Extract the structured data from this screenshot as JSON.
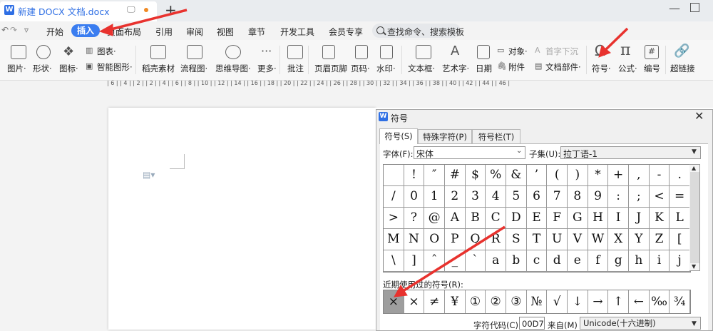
{
  "tab": {
    "app_icon": "W",
    "title": "新建 DOCX 文档.docx",
    "new_tab": "+",
    "minimize": "—"
  },
  "menu": {
    "quick_undo": "↶",
    "quick_redo": "↷",
    "quick_dropdown": "▿",
    "items": [
      "开始",
      "插入",
      "页面布局",
      "引用",
      "审阅",
      "视图",
      "章节",
      "开发工具",
      "会员专享"
    ],
    "search_placeholder": "查找命令、搜索模板"
  },
  "ribbon": {
    "picture": "图片·",
    "shape": "形状·",
    "icon": "图标·",
    "chart": "图表·",
    "smart_graphic": "智能图形·",
    "straw_material": "稻壳素材",
    "flowchart": "流程图·",
    "mindmap": "思维导图·",
    "more": "更多·",
    "comment": "批注",
    "header_footer": "页眉页脚",
    "page_number": "页码·",
    "watermark": "水印·",
    "textbox": "文本框·",
    "wordart": "艺术字·",
    "date": "日期",
    "object": "对象·",
    "attachment": "附件",
    "dropcap": "首字下沉",
    "doc_parts": "文档部件·",
    "symbol": "符号·",
    "formula": "公式·",
    "numbering": "编号",
    "hyperlink": "超链接",
    "formula_glyph": "π",
    "numbering_glyph": "#",
    "symbol_glyph": "Ω"
  },
  "ruler": {
    "text": "| 6 |  | 4 |  | 2 |          | 2 |  | 4 |  | 6 |  | 8 |  | 10 |  | 12 |  | 14 |  | 16 |  | 18 |  | 20 |  | 22 |  | 24 |  | 26 |  | 28 |  | 30 |  | 32 |  | 34 |  | 36 |  | 38 |  | 40 |  | 42 |  | 44 |  | 46 |"
  },
  "dialog": {
    "icon": "W",
    "title": "符号",
    "close": "✕",
    "tabs": [
      "符号(S)",
      "特殊字符(P)",
      "符号栏(T)"
    ],
    "font_label": "字体(F):",
    "font_value": "宋体",
    "subset_label": "子集(U):",
    "subset_value": "拉丁语-1",
    "symbols": [
      [
        "",
        "!",
        "″",
        "#",
        "$",
        "%",
        "&",
        "’",
        "(",
        ")",
        "*",
        "+",
        ",",
        "-",
        "."
      ],
      [
        "/",
        "0",
        "1",
        "2",
        "3",
        "4",
        "5",
        "6",
        "7",
        "8",
        "9",
        ":",
        ";",
        "<",
        "="
      ],
      [
        ">",
        "?",
        "@",
        "A",
        "B",
        "C",
        "D",
        "E",
        "F",
        "G",
        "H",
        "I",
        "J",
        "K",
        "L"
      ],
      [
        "M",
        "N",
        "O",
        "P",
        "Q",
        "R",
        "S",
        "T",
        "U",
        "V",
        "W",
        "X",
        "Y",
        "Z",
        "["
      ],
      [
        "\\",
        "]",
        "ˆ",
        "_",
        "`",
        "a",
        "b",
        "c",
        "d",
        "e",
        "f",
        "g",
        "h",
        "i",
        "j"
      ]
    ],
    "recent_label": "近期使用过的符号(R):",
    "recent": [
      "×",
      "×",
      "≠",
      "¥",
      "①",
      "②",
      "③",
      "№",
      "√",
      "↓",
      "→",
      "↑",
      "←",
      "‰",
      "¾"
    ],
    "code_label": "字符代码(C):",
    "code_value": "00D7",
    "from_label": "来自(M)",
    "from_value": "Unicode(十六进制)"
  },
  "colors": {
    "accent": "#3a7df0",
    "arrow": "#e8322e",
    "selected_cell": "#9e9e9e"
  }
}
